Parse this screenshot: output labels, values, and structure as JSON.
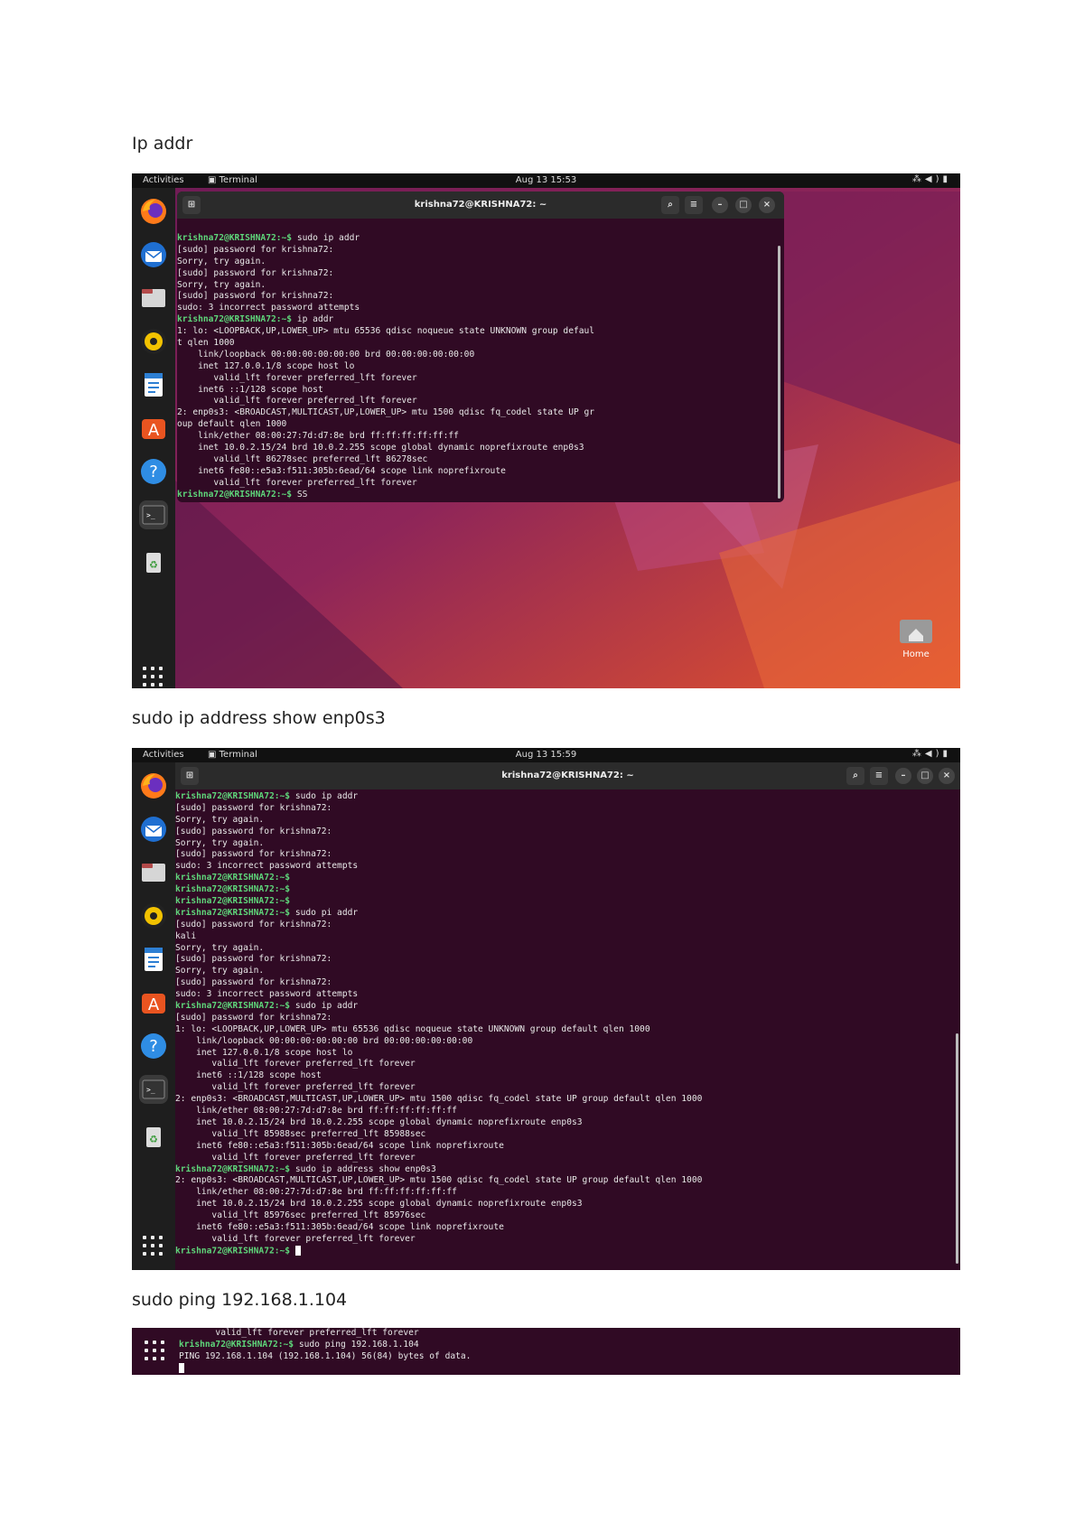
{
  "headings": {
    "h1": "Ip addr",
    "h2": "sudo ip address show enp0s3",
    "h3": "sudo ping 192.168.1.104"
  },
  "shot1": {
    "topbar": {
      "activities": "Activities",
      "terminal": "Terminal",
      "clock": "Aug 13  15:53"
    },
    "window_title": "krishna72@KRISHNA72: ~",
    "desktop_home_label": "Home",
    "prompt": "krishna72@KRISHNA72:~$",
    "lines": [
      {
        "prompt": true,
        "text": " sudo ip addr"
      },
      {
        "text": "[sudo] password for krishna72:"
      },
      {
        "text": "Sorry, try again."
      },
      {
        "text": "[sudo] password for krishna72:"
      },
      {
        "text": "Sorry, try again."
      },
      {
        "text": "[sudo] password for krishna72:"
      },
      {
        "text": "sudo: 3 incorrect password attempts"
      },
      {
        "prompt": true,
        "text": " ip addr"
      },
      {
        "text": "1: lo: <LOOPBACK,UP,LOWER_UP> mtu 65536 qdisc noqueue state UNKNOWN group defaul"
      },
      {
        "text": "t qlen 1000"
      },
      {
        "text": "    link/loopback 00:00:00:00:00:00 brd 00:00:00:00:00:00"
      },
      {
        "text": "    inet 127.0.0.1/8 scope host lo"
      },
      {
        "text": "       valid_lft forever preferred_lft forever"
      },
      {
        "text": "    inet6 ::1/128 scope host"
      },
      {
        "text": "       valid_lft forever preferred_lft forever"
      },
      {
        "text": "2: enp0s3: <BROADCAST,MULTICAST,UP,LOWER_UP> mtu 1500 qdisc fq_codel state UP gr"
      },
      {
        "text": "oup default qlen 1000"
      },
      {
        "text": "    link/ether 08:00:27:7d:d7:8e brd ff:ff:ff:ff:ff:ff"
      },
      {
        "text": "    inet 10.0.2.15/24 brd 10.0.2.255 scope global dynamic noprefixroute enp0s3"
      },
      {
        "text": "       valid_lft 86278sec preferred_lft 86278sec"
      },
      {
        "text": "    inet6 fe80::e5a3:f511:305b:6ead/64 scope link noprefixroute"
      },
      {
        "text": "       valid_lft forever preferred_lft forever"
      },
      {
        "prompt": true,
        "text": " SS"
      }
    ]
  },
  "shot2": {
    "topbar": {
      "activities": "Activities",
      "terminal": "Terminal",
      "clock": "Aug 13  15:59"
    },
    "window_title": "krishna72@KRISHNA72: ~",
    "prompt": "krishna72@KRISHNA72:~$",
    "lines": [
      {
        "prompt": true,
        "text": " sudo ip addr"
      },
      {
        "text": "[sudo] password for krishna72:"
      },
      {
        "text": "Sorry, try again."
      },
      {
        "text": "[sudo] password for krishna72:"
      },
      {
        "text": "Sorry, try again."
      },
      {
        "text": "[sudo] password for krishna72:"
      },
      {
        "text": "sudo: 3 incorrect password attempts"
      },
      {
        "prompt": true,
        "text": ""
      },
      {
        "prompt": true,
        "text": ""
      },
      {
        "prompt": true,
        "text": ""
      },
      {
        "prompt": true,
        "text": " sudo pi addr"
      },
      {
        "text": "[sudo] password for krishna72:"
      },
      {
        "text": "kali"
      },
      {
        "text": "Sorry, try again."
      },
      {
        "text": "[sudo] password for krishna72:"
      },
      {
        "text": "Sorry, try again."
      },
      {
        "text": "[sudo] password for krishna72:"
      },
      {
        "text": "sudo: 3 incorrect password attempts"
      },
      {
        "prompt": true,
        "text": " sudo ip addr"
      },
      {
        "text": "[sudo] password for krishna72:"
      },
      {
        "text": "1: lo: <LOOPBACK,UP,LOWER_UP> mtu 65536 qdisc noqueue state UNKNOWN group default qlen 1000"
      },
      {
        "text": "    link/loopback 00:00:00:00:00:00 brd 00:00:00:00:00:00"
      },
      {
        "text": "    inet 127.0.0.1/8 scope host lo"
      },
      {
        "text": "       valid_lft forever preferred_lft forever"
      },
      {
        "text": "    inet6 ::1/128 scope host"
      },
      {
        "text": "       valid_lft forever preferred_lft forever"
      },
      {
        "text": "2: enp0s3: <BROADCAST,MULTICAST,UP,LOWER_UP> mtu 1500 qdisc fq_codel state UP group default qlen 1000"
      },
      {
        "text": "    link/ether 08:00:27:7d:d7:8e brd ff:ff:ff:ff:ff:ff"
      },
      {
        "text": "    inet 10.0.2.15/24 brd 10.0.2.255 scope global dynamic noprefixroute enp0s3"
      },
      {
        "text": "       valid_lft 85988sec preferred_lft 85988sec"
      },
      {
        "text": "    inet6 fe80::e5a3:f511:305b:6ead/64 scope link noprefixroute"
      },
      {
        "text": "       valid_lft forever preferred_lft forever"
      },
      {
        "prompt": true,
        "text": " sudo ip address show enp0s3"
      },
      {
        "text": "2: enp0s3: <BROADCAST,MULTICAST,UP,LOWER_UP> mtu 1500 qdisc fq_codel state UP group default qlen 1000"
      },
      {
        "text": "    link/ether 08:00:27:7d:d7:8e brd ff:ff:ff:ff:ff:ff"
      },
      {
        "text": "    inet 10.0.2.15/24 brd 10.0.2.255 scope global dynamic noprefixroute enp0s3"
      },
      {
        "text": "       valid_lft 85976sec preferred_lft 85976sec"
      },
      {
        "text": "    inet6 fe80::e5a3:f511:305b:6ead/64 scope link noprefixroute"
      },
      {
        "text": "       valid_lft forever preferred_lft forever"
      },
      {
        "prompt": true,
        "text": " ",
        "cursor": true
      }
    ]
  },
  "shot3": {
    "prompt": "krishna72@KRISHNA72:~$",
    "lines": [
      {
        "text": "       valid_lft forever preferred_lft forever"
      },
      {
        "prompt": true,
        "text": " sudo ping 192.168.1.104"
      },
      {
        "text": "PING 192.168.1.104 (192.168.1.104) 56(84) bytes of data."
      },
      {
        "text": "",
        "cursor": true
      }
    ]
  },
  "colors": {
    "terminal_bg": "#300a24",
    "prompt": "#5ed67a",
    "ubuntu_orange": "#e95420"
  },
  "icons": [
    "firefox-icon",
    "thunderbird-icon",
    "files-icon",
    "rhythmbox-icon",
    "writer-icon",
    "app-center-icon",
    "help-icon",
    "terminal-icon",
    "trash-icon",
    "show-apps-icon",
    "home-folder-icon"
  ]
}
